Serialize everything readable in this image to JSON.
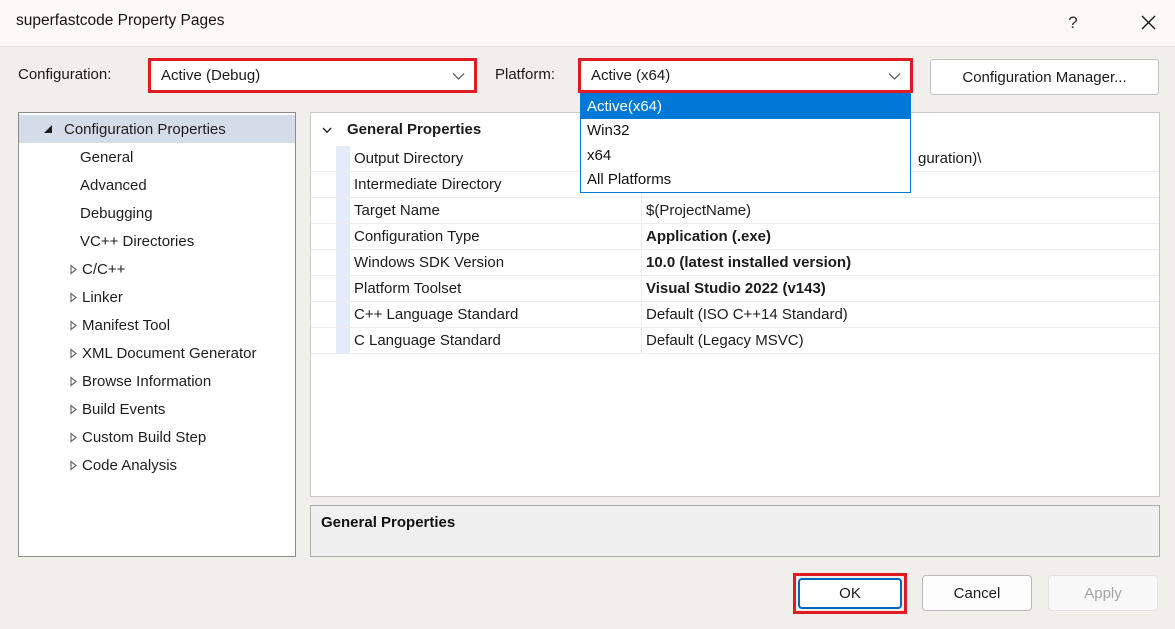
{
  "window": {
    "title": "superfastcode Property Pages",
    "help_glyph": "?"
  },
  "colors": {
    "highlight_red": "#e01b24",
    "selection_blue": "#0078d7",
    "default_button_border_blue": "#0267c1",
    "tree_selection": "#d5dce9",
    "gutter_blue": "#e3ecf8"
  },
  "toolbar": {
    "configuration_label": "Configuration:",
    "configuration_value": "Active (Debug)",
    "platform_label": "Platform:",
    "platform_value": "Active (x64)",
    "configuration_manager_button": "Configuration Manager..."
  },
  "platform_dropdown": {
    "items": [
      {
        "label": "Active(x64)",
        "selected": true
      },
      {
        "label": "Win32",
        "selected": false
      },
      {
        "label": "x64",
        "selected": false
      },
      {
        "label": "All Platforms",
        "selected": false
      }
    ]
  },
  "tree": {
    "items": [
      {
        "label": "Configuration Properties",
        "level": 0,
        "state": "expanded",
        "selected": true
      },
      {
        "label": "General",
        "level": 1,
        "state": "leaf"
      },
      {
        "label": "Advanced",
        "level": 1,
        "state": "leaf"
      },
      {
        "label": "Debugging",
        "level": 1,
        "state": "leaf"
      },
      {
        "label": "VC++ Directories",
        "level": 1,
        "state": "leaf"
      },
      {
        "label": "C/C++",
        "level": 1,
        "state": "collapsed"
      },
      {
        "label": "Linker",
        "level": 1,
        "state": "collapsed"
      },
      {
        "label": "Manifest Tool",
        "level": 1,
        "state": "collapsed"
      },
      {
        "label": "XML Document Generator",
        "level": 1,
        "state": "collapsed"
      },
      {
        "label": "Browse Information",
        "level": 1,
        "state": "collapsed"
      },
      {
        "label": "Build Events",
        "level": 1,
        "state": "collapsed"
      },
      {
        "label": "Custom Build Step",
        "level": 1,
        "state": "collapsed"
      },
      {
        "label": "Code Analysis",
        "level": 1,
        "state": "collapsed"
      }
    ]
  },
  "property_grid": {
    "section_header": "General Properties",
    "rows": [
      {
        "name": "Output Directory",
        "value": "guration)\\",
        "bold": false,
        "note_visible_fragment_only": true
      },
      {
        "name": "Intermediate Directory",
        "value": "",
        "bold": false
      },
      {
        "name": "Target Name",
        "value": "$(ProjectName)",
        "bold": false
      },
      {
        "name": "Configuration Type",
        "value": "Application (.exe)",
        "bold": true
      },
      {
        "name": "Windows SDK Version",
        "value": "10.0 (latest installed version)",
        "bold": true
      },
      {
        "name": "Platform Toolset",
        "value": "Visual Studio 2022 (v143)",
        "bold": true
      },
      {
        "name": "C++ Language Standard",
        "value": "Default (ISO C++14 Standard)",
        "bold": false
      },
      {
        "name": "C Language Standard",
        "value": "Default (Legacy MSVC)",
        "bold": false
      }
    ]
  },
  "description_box": {
    "title": "General Properties"
  },
  "footer": {
    "ok": "OK",
    "cancel": "Cancel",
    "apply": "Apply"
  }
}
